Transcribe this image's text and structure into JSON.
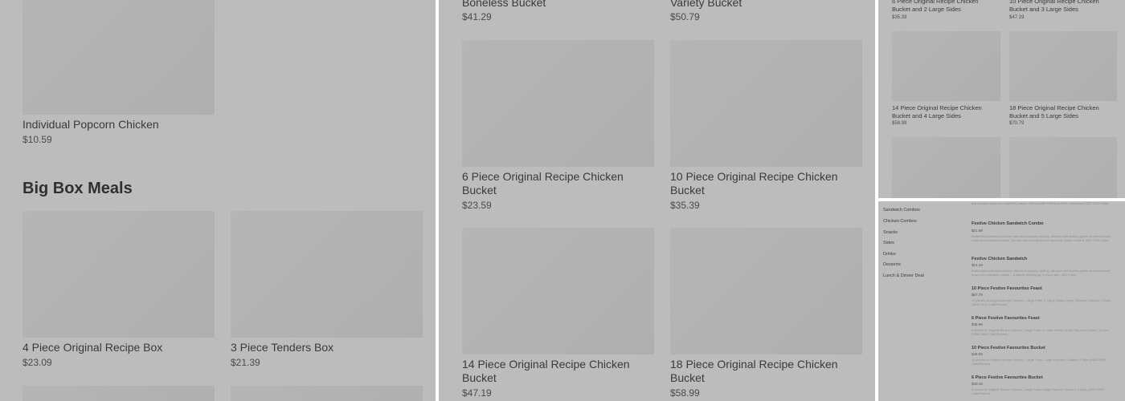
{
  "panel1": {
    "popcorn": {
      "name": "Individual Popcorn Chicken",
      "price": "$10.59"
    },
    "section_title": "Big Box Meals",
    "items": [
      {
        "name": "4 Piece Original Recipe Box",
        "price": "$23.09"
      },
      {
        "name": "3 Piece Tenders Box",
        "price": "$21.39"
      }
    ]
  },
  "panel2": {
    "top": [
      {
        "name": "Boneless Bucket",
        "price": "$41.29"
      },
      {
        "name": "Variety Bucket",
        "price": "$50.79"
      }
    ],
    "items": [
      {
        "name": "6 Piece Original Recipe Chicken Bucket",
        "price": "$23.59"
      },
      {
        "name": "10 Piece Original Recipe Chicken Bucket",
        "price": "$35.39"
      },
      {
        "name": "14 Piece Original Recipe Chicken Bucket",
        "price": "$47.19"
      },
      {
        "name": "18 Piece Original Recipe Chicken Bucket",
        "price": "$58.99"
      }
    ]
  },
  "panel3": {
    "items": [
      {
        "name": "6 Piece Original Recipe Chicken Bucket and 2 Large Sides",
        "price": "$35.39"
      },
      {
        "name": "10 Piece Original Recipe Chicken Bucket and 3 Large Sides",
        "price": "$47.19"
      },
      {
        "name": "14 Piece Original Recipe Chicken Bucket and 4 Large Sides",
        "price": "$58.99"
      },
      {
        "name": "18 Piece Original Recipe Chicken Bucket and 5 Large Sides",
        "price": "$70.79"
      }
    ]
  },
  "panel4": {
    "nav": [
      "Sandwich Combos",
      "Chicken Combos",
      "Snacks",
      "Sides",
      "Drinks",
      "Desserts",
      "Lunch & Dinner Deal"
    ],
    "top_desc": "plant-based mayo and cranberry sauce. Served with individual fries. Individual (1250-1660 Cals)",
    "items": [
      {
        "name": "Festive Chicken Sandwich Combo",
        "price": "$21.89",
        "desc": "Buttermilk-marinated chicken fillet and savoury stuffing, drizzled with buttery garlic on plant-based mayo and cranberry sauce. Served with individual fries and your choice of drink (880-1250 Cals)"
      },
      {
        "name": "Festive Chicken Sandwich",
        "price": "$14.19",
        "desc": "Buttermilk-marinated chicken fillet and savoury stuffing, drizzled with buttery garlic on plant-based mayo and cranberry sauce – a simple holiday joy in every bite. (600 Cals)"
      },
      {
        "name": "10 Piece Festive Favourites Feast",
        "price": "$57.79",
        "desc": "10 pieces of Original Recipe Chicken, Large Fries, 2 Large Sides, Large Popcorn Chicken, 3 Dips (3610-5151 Cals/Person)"
      },
      {
        "name": "6 Piece Festive Favourites Feast",
        "price": "$45.99",
        "desc": "6 pieces of Original Recipe Chicken, Large Fries, 2 Large Sides, Large Popcorn Chicken, 3 Dips (2690-3390 Cals/Person)"
      },
      {
        "name": "10 Piece Festive Favourites Bucket",
        "price": "$48.59",
        "desc": "10 pieces of Original Recipe Chicken, Large Fries, Large Popcorn Chicken, 3 Dips (3150-3680 Cals/Person)"
      },
      {
        "name": "6 Piece Festive Favourites Bucket",
        "price": "$40.19",
        "desc": "6 pieces of Original Recipe Chicken, Large Fries, Large Popcorn Chicken, 3 Dips (2250-2910 Cals/Person)"
      }
    ]
  }
}
